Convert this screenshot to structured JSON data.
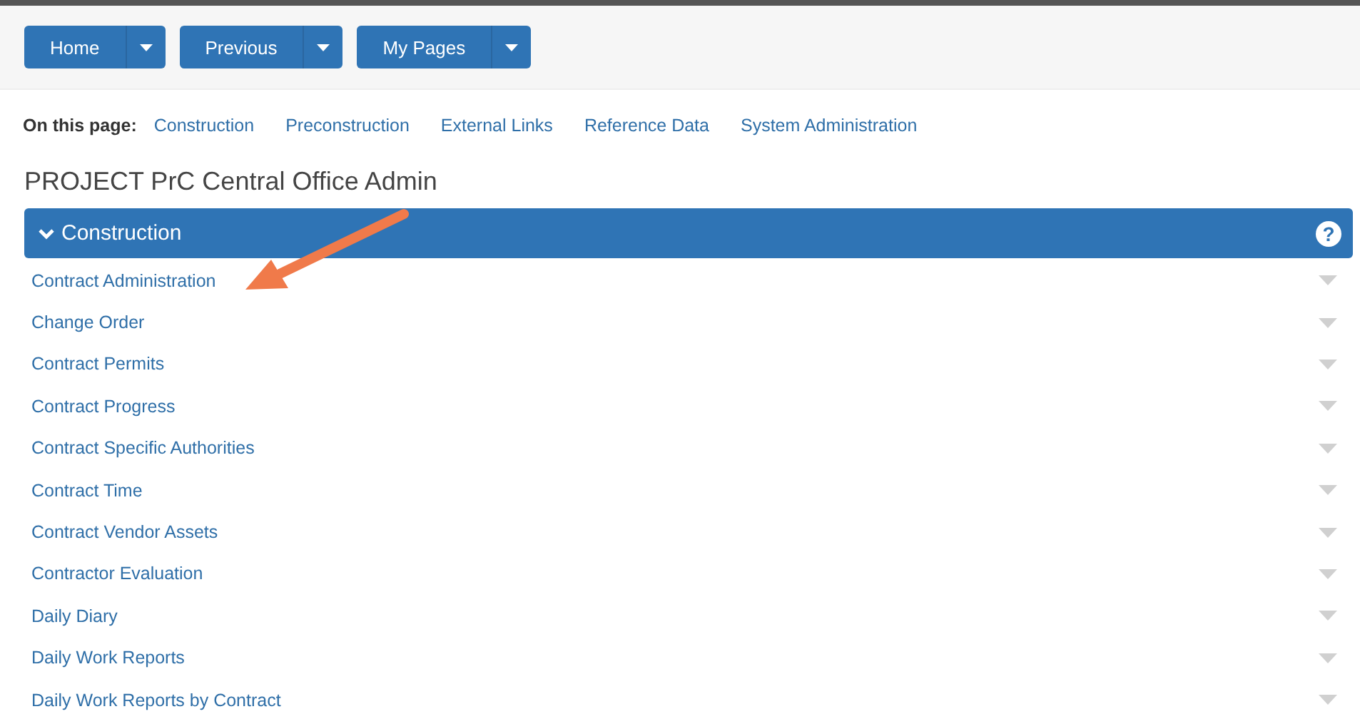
{
  "nav_buttons": [
    {
      "label": "Home"
    },
    {
      "label": "Previous"
    },
    {
      "label": "My Pages"
    }
  ],
  "on_this_page": {
    "label": "On this page:",
    "links": [
      "Construction",
      "Preconstruction",
      "External Links",
      "Reference Data",
      "System Administration"
    ]
  },
  "page_title": "PROJECT PrC Central Office Admin",
  "section": {
    "title": "Construction",
    "expanded": true,
    "help": "?",
    "items": [
      {
        "label": "Contract Administration"
      },
      {
        "label": "Change Order"
      },
      {
        "label": "Contract Permits"
      },
      {
        "label": "Contract Progress"
      },
      {
        "label": "Contract Specific Authorities"
      },
      {
        "label": "Contract Time"
      },
      {
        "label": "Contract Vendor Assets"
      },
      {
        "label": "Contractor Evaluation"
      },
      {
        "label": "Daily Diary"
      },
      {
        "label": "Daily Work Reports"
      },
      {
        "label": "Daily Work Reports by Contract"
      }
    ]
  }
}
